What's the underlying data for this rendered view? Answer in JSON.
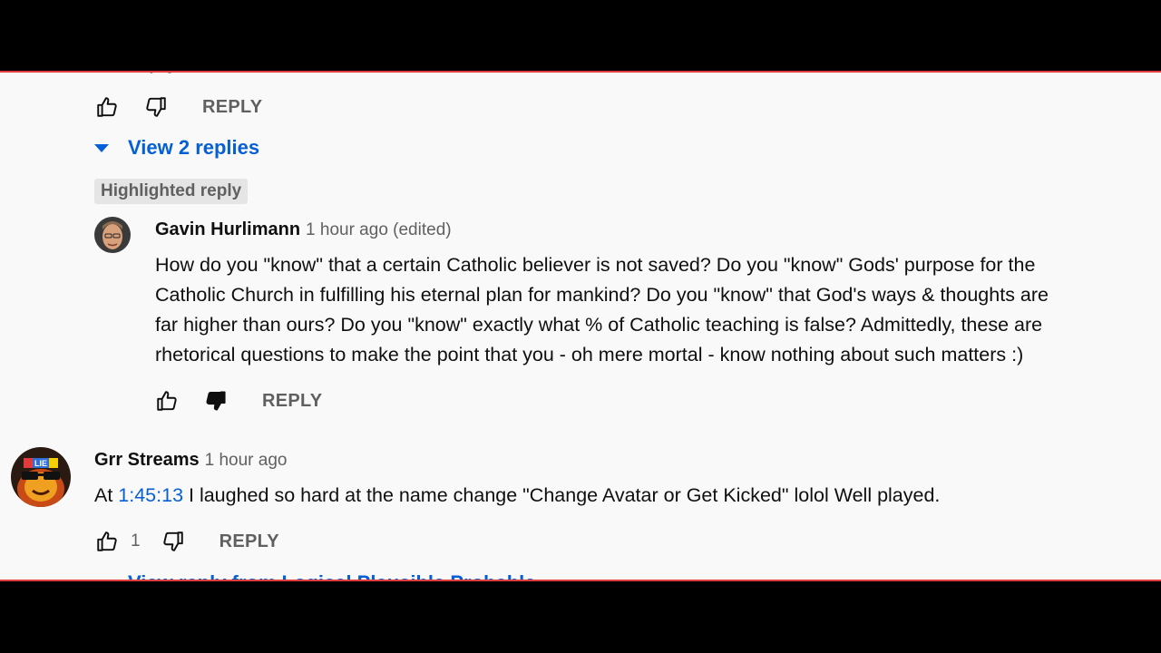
{
  "top_comment": {
    "cut_text": "y                                   g",
    "reply_label": "REPLY",
    "view_replies_label": "View 2 replies"
  },
  "highlighted_reply": {
    "badge": "Highlighted reply",
    "author": "Gavin Hurlimann",
    "time": "1 hour ago (edited)",
    "text_lines": [
      "How do you \"know\" that a certain Catholic believer is not saved? Do you \"know\" Gods' purpose for the",
      "Catholic Church in fulfilling his eternal plan for mankind? Do you \"know\" that God's ways & thoughts are",
      "far higher than ours? Do you \"know\" exactly what % of Catholic teaching is false? Admittedly, these are",
      "rhetorical questions to make the point that you - oh mere mortal - know nothing about such matters :)"
    ],
    "reply_label": "REPLY",
    "disliked": true
  },
  "comment2": {
    "author": "Grr Streams",
    "time": "1 hour ago",
    "text_prefix": "At ",
    "timestamp": "1:45:13",
    "text_suffix": " I laughed so hard at the name change \"Change Avatar or Get Kicked\" lolol Well played.",
    "like_count": "1",
    "reply_label": "REPLY",
    "avatar_badge": "LIE",
    "view_reply_label": "View reply from Logical Plausible Probable"
  },
  "colors": {
    "link": "#065fd4",
    "secondary_text": "#606060",
    "panel_bg": "#f9f9f9",
    "border": "#e23b3b"
  }
}
